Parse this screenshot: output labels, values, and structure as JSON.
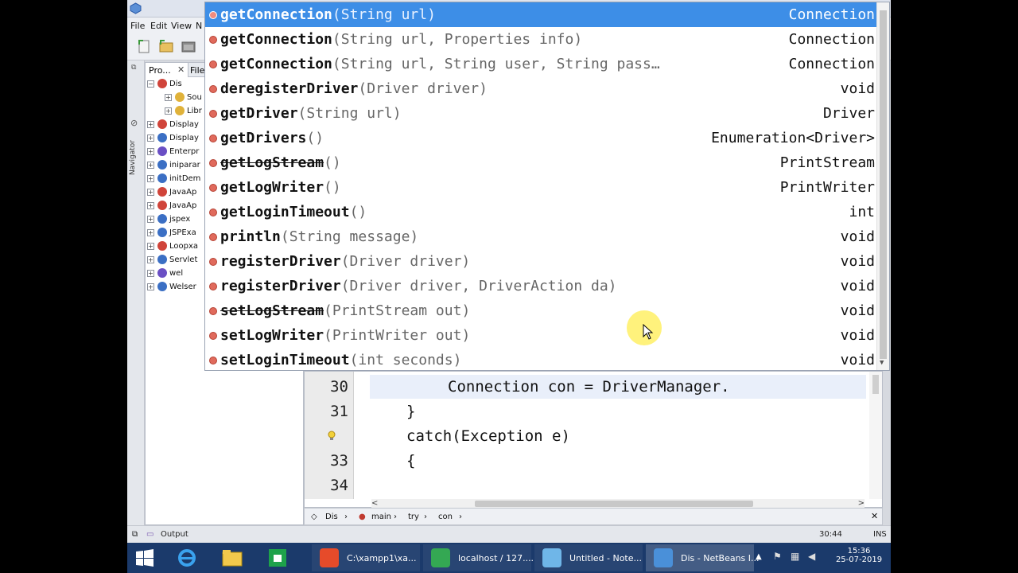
{
  "menu": {
    "file": "File",
    "edit": "Edit",
    "view": "View",
    "nav": "N"
  },
  "navigator_label": "Navigator",
  "projects": {
    "tab_label": "Pro...",
    "close_glyph": "✕",
    "files_tab": "File",
    "tree": [
      {
        "label": "Dis",
        "expander": "−",
        "icon_color": "#d0443a"
      },
      {
        "label": "Sou",
        "expander": "+",
        "icon_color": "#e0b23a"
      },
      {
        "label": "Libr",
        "expander": "+",
        "icon_color": "#e0b23a"
      },
      {
        "label": "Display",
        "expander": "+",
        "icon_color": "#d0443a"
      },
      {
        "label": "Display",
        "expander": "+",
        "icon_color": "#3b6fc4"
      },
      {
        "label": "Enterpr",
        "expander": "+",
        "icon_color": "#6a4fc4"
      },
      {
        "label": "iniparar",
        "expander": "+",
        "icon_color": "#3b6fc4"
      },
      {
        "label": "initDem",
        "expander": "+",
        "icon_color": "#3b6fc4"
      },
      {
        "label": "JavaAp",
        "expander": "+",
        "icon_color": "#d0443a"
      },
      {
        "label": "JavaAp",
        "expander": "+",
        "icon_color": "#d0443a"
      },
      {
        "label": "jspex",
        "expander": "+",
        "icon_color": "#3b6fc4"
      },
      {
        "label": "JSPExa",
        "expander": "+",
        "icon_color": "#3b6fc4"
      },
      {
        "label": "Loopxa",
        "expander": "+",
        "icon_color": "#d0443a"
      },
      {
        "label": "Servlet",
        "expander": "+",
        "icon_color": "#3b6fc4"
      },
      {
        "label": "wel",
        "expander": "+",
        "icon_color": "#6a4fc4"
      },
      {
        "label": "Welser",
        "expander": "+",
        "icon_color": "#3b6fc4"
      }
    ]
  },
  "autocomplete": [
    {
      "name": "getConnection",
      "sig": "(String url)",
      "ret": "Connection",
      "selected": true
    },
    {
      "name": "getConnection",
      "sig": "(String url, Properties info)",
      "ret": "Connection"
    },
    {
      "name": "getConnection",
      "sig": "(String url, String user, String pass…",
      "ret": "Connection"
    },
    {
      "name": "deregisterDriver",
      "sig": "(Driver driver)",
      "ret": "void"
    },
    {
      "name": "getDriver",
      "sig": "(String url)",
      "ret": "Driver"
    },
    {
      "name": "getDrivers",
      "sig": "()",
      "ret": "Enumeration<Driver>"
    },
    {
      "name": "getLogStream",
      "sig": "()",
      "ret": "PrintStream",
      "deprecated": true
    },
    {
      "name": "getLogWriter",
      "sig": "()",
      "ret": "PrintWriter"
    },
    {
      "name": "getLoginTimeout",
      "sig": "()",
      "ret": "int"
    },
    {
      "name": "println",
      "sig": "(String message)",
      "ret": "void"
    },
    {
      "name": "registerDriver",
      "sig": "(Driver driver)",
      "ret": "void"
    },
    {
      "name": "registerDriver",
      "sig": "(Driver driver, DriverAction da)",
      "ret": "void"
    },
    {
      "name": "setLogStream",
      "sig": "(PrintStream out)",
      "ret": "void",
      "deprecated": true
    },
    {
      "name": "setLogWriter",
      "sig": "(PrintWriter out)",
      "ret": "void"
    },
    {
      "name": "setLoginTimeout",
      "sig": "(int seconds)",
      "ret": "void"
    }
  ],
  "editor": {
    "lines": [
      {
        "num": "30",
        "code": "Connection con = DriverManager.",
        "indent": 3
      },
      {
        "num": "31",
        "code": "}",
        "indent": 1
      },
      {
        "num": "",
        "code": "catch(Exception e)",
        "indent": 1
      },
      {
        "num": "33",
        "code": "{",
        "indent": 1
      },
      {
        "num": "34",
        "code": "",
        "indent": 0
      }
    ]
  },
  "breadcrumb": {
    "class": "Dis",
    "method": "main",
    "block": "try",
    "var": "con"
  },
  "status": {
    "output_label": "Output",
    "position": "30:44",
    "mode": "INS"
  },
  "taskbar": {
    "items": [
      {
        "label": "C:\\xampp1\\xa...",
        "color": "#e64b2a"
      },
      {
        "label": "localhost / 127....",
        "color": "#34a853"
      },
      {
        "label": "Untitled - Note...",
        "color": "#6fb6e8"
      },
      {
        "label": "Dis - NetBeans I...",
        "color": "#4a90d9"
      }
    ],
    "time": "15:36",
    "date": "25-07-2019"
  }
}
